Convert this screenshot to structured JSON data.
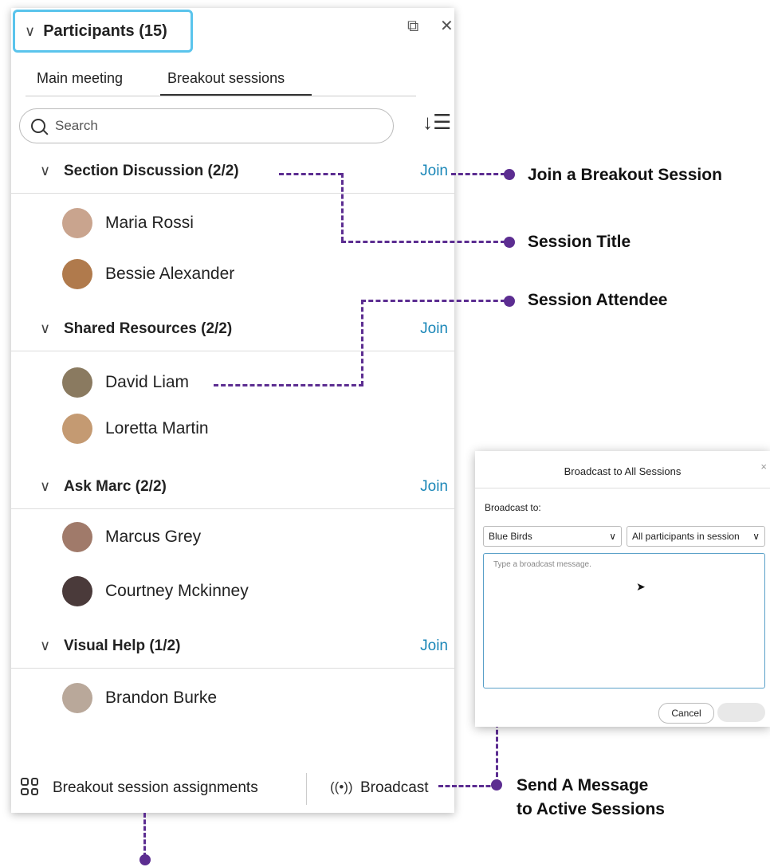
{
  "panel": {
    "title": "Participants (15)",
    "tabs": [
      "Main meeting",
      "Breakout sessions"
    ],
    "search_placeholder": "Search",
    "sessions": [
      {
        "name": "Section Discussion (2/2)",
        "join": "Join",
        "members": [
          "Maria Rossi",
          "Bessie Alexander"
        ]
      },
      {
        "name": "Shared Resources (2/2)",
        "join": "Join",
        "members": [
          "David Liam",
          "Loretta Martin"
        ]
      },
      {
        "name": "Ask Marc (2/2)",
        "join": "Join",
        "members": [
          "Marcus Grey",
          "Courtney Mckinney"
        ]
      },
      {
        "name": "Visual Help (1/2)",
        "join": "Join",
        "members": [
          "Brandon Burke"
        ]
      }
    ],
    "footer": {
      "assignments_label": "Breakout session assignments",
      "broadcast_label": "Broadcast"
    }
  },
  "annotations": {
    "join_session": "Join a Breakout Session",
    "session_title": "Session Title",
    "session_attendee": "Session Attendee",
    "send_message_line1": "Send A Message",
    "send_message_line2": "to Active Sessions"
  },
  "dialog": {
    "title": "Broadcast to All Sessions",
    "broadcast_to_label": "Broadcast to:",
    "session_select": "Blue Birds",
    "audience_select": "All participants in session",
    "message_placeholder": "Type a broadcast message.",
    "cancel_label": "Cancel"
  },
  "colors": {
    "accent": "#1b87b8",
    "annotation": "#5c2d91",
    "title_highlight": "#5ac4ec"
  }
}
